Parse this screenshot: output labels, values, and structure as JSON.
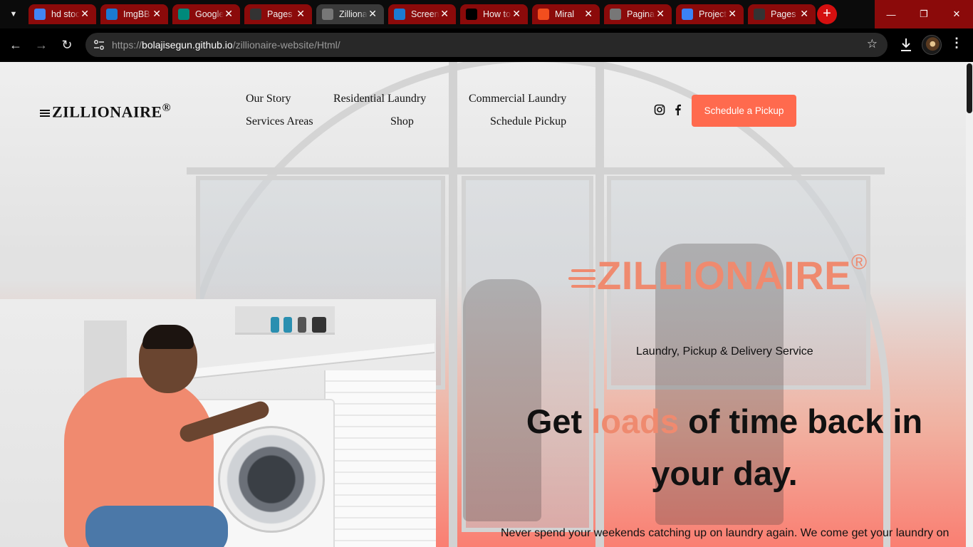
{
  "browser": {
    "tabs": [
      {
        "title": "hd stock",
        "favicon": "google-icon",
        "color": "#4285f4"
      },
      {
        "title": "ImgBB",
        "favicon": "imgbb-icon",
        "color": "#1b7ad3"
      },
      {
        "title": "Google Meet",
        "favicon": "meet-icon",
        "color": "#00897b"
      },
      {
        "title": "Pages",
        "favicon": "github-icon",
        "color": "#333333"
      },
      {
        "title": "Zillionaire",
        "favicon": "globe-icon",
        "color": "#777777"
      },
      {
        "title": "Screenshot",
        "favicon": "imgbb-icon",
        "color": "#1b7ad3"
      },
      {
        "title": "How to",
        "favicon": "medium-icon",
        "color": "#000000"
      },
      {
        "title": "Miral",
        "favicon": "figma-icon",
        "color": "#f24e1e"
      },
      {
        "title": "Pagination",
        "favicon": "globe-icon",
        "color": "#777777"
      },
      {
        "title": "Projects",
        "favicon": "app-icon",
        "color": "#3b82f6"
      },
      {
        "title": "Pages",
        "favicon": "github-icon",
        "color": "#333333"
      }
    ],
    "active_tab": 4,
    "url_scheme": "https://",
    "url_host": "bolajisegun.github.io",
    "url_path": "/zillionaire-website/Html/"
  },
  "header": {
    "brand": "ZILLIONAIRE",
    "brand_mark": "®",
    "nav": {
      "our_story": "Our Story",
      "residential": "Residential Laundry",
      "commercial": "Commercial Laundry",
      "services": "Services Areas",
      "shop": "Shop",
      "schedule": "Schedule Pickup"
    },
    "social": [
      "instagram-icon",
      "facebook-icon"
    ],
    "cta_label": "Schedule a Pickup"
  },
  "hero": {
    "logo_text": "ZILLIONAIRE",
    "logo_mark": "®",
    "tagline": "Laundry, Pickup & Delivery Service",
    "headline_pre": "Get ",
    "headline_accent": "loads",
    "headline_post": " of time back in your day.",
    "subline": "Never spend your weekends catching up on laundry again. We come get your laundry on"
  },
  "colors": {
    "accent": "#ef8a6f",
    "cta": "#ff6a4e",
    "tab_bg": "#8b0a0a"
  }
}
